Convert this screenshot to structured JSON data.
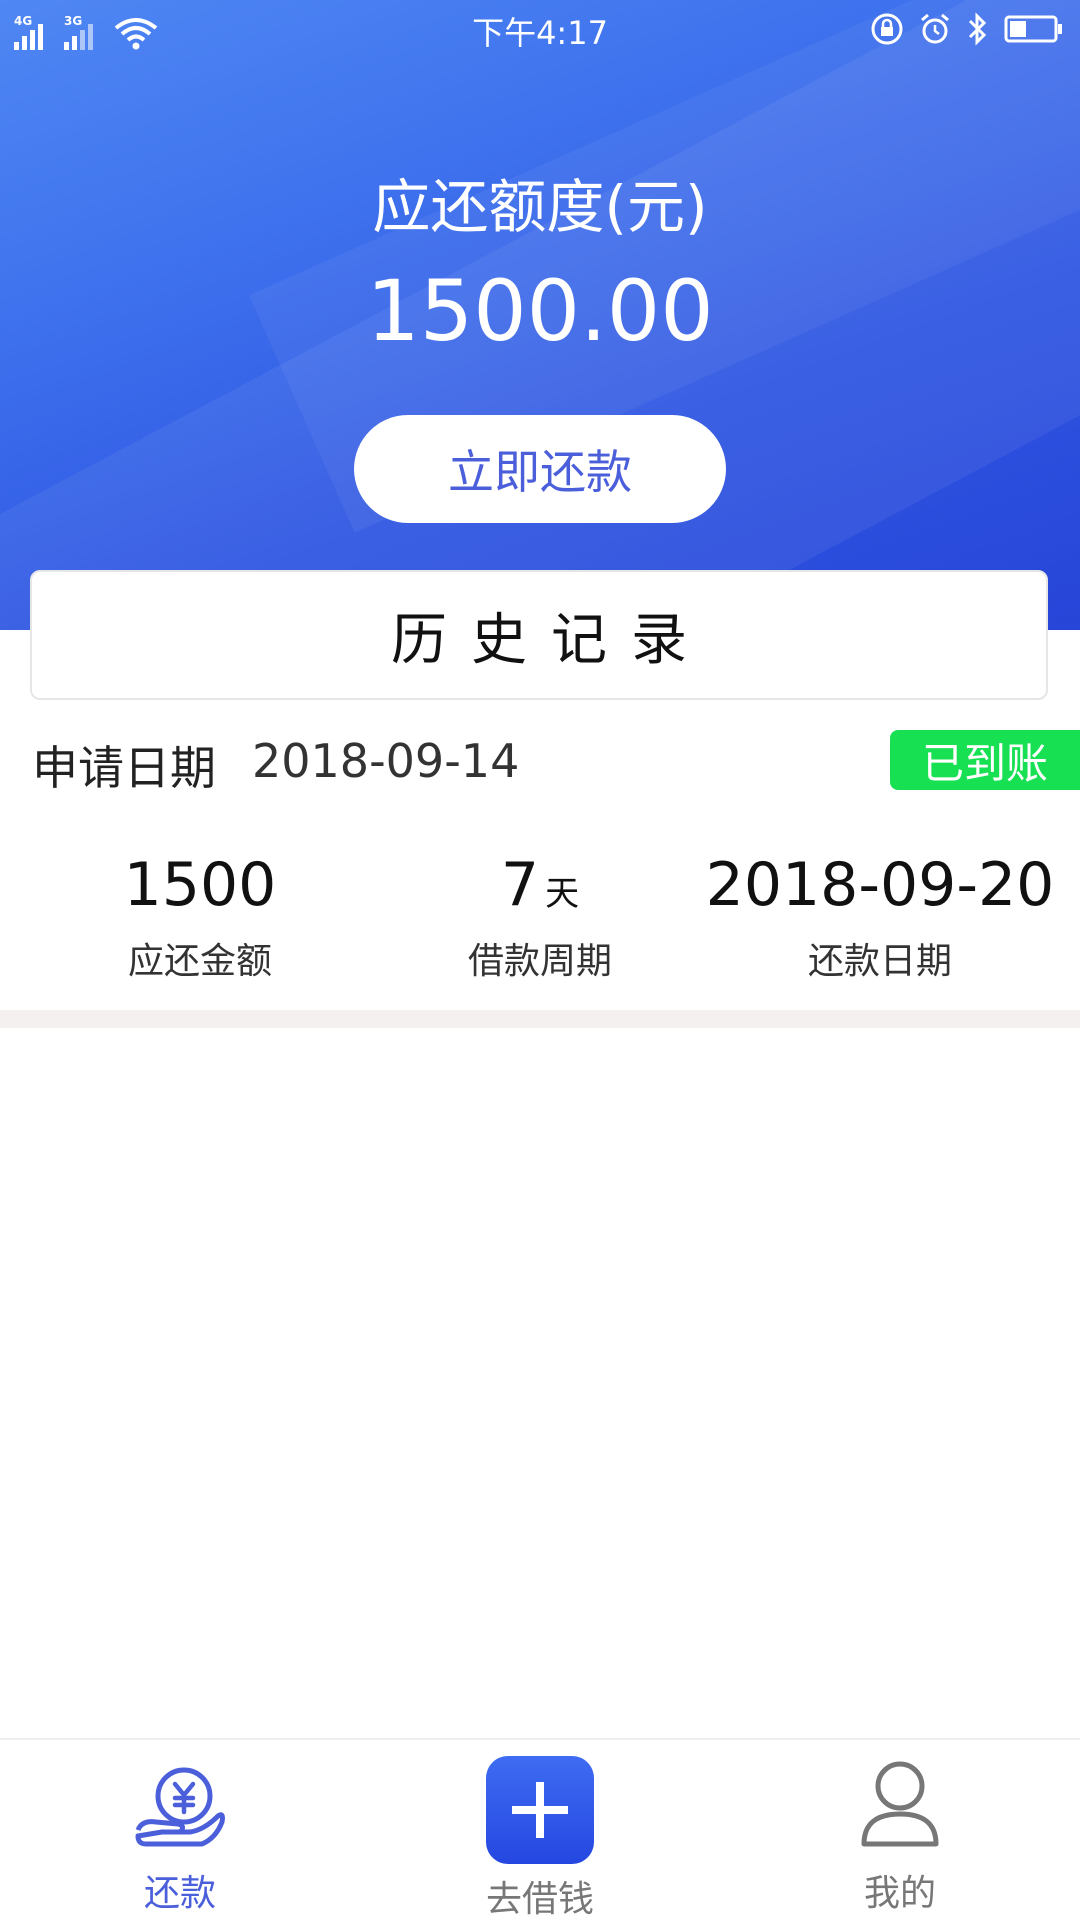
{
  "status_bar": {
    "network_1": "4G",
    "network_2": "3G",
    "time": "下午4:17"
  },
  "repayment": {
    "limit_label": "应还额度(元)",
    "limit_amount": "1500.00",
    "repay_button_label": "立即还款"
  },
  "history": {
    "tab_label": "历史记录",
    "record": {
      "apply_label": "申请日期",
      "apply_date": "2018-09-14",
      "status": "已到账",
      "status_color": "#18e053",
      "stats": [
        {
          "value": "1500",
          "unit": "",
          "label": "应还金额"
        },
        {
          "value": "7",
          "unit": "天",
          "label": "借款周期"
        },
        {
          "value": "2018-09-20",
          "unit": "",
          "label": "还款日期"
        }
      ]
    }
  },
  "tabbar": {
    "items": [
      {
        "label": "还款",
        "icon": "hand-yen-icon",
        "active": true
      },
      {
        "label": "去借钱",
        "icon": "plus-icon",
        "active": false
      },
      {
        "label": "我的",
        "icon": "user-icon",
        "active": false
      }
    ]
  },
  "colors": {
    "accent": "#4b5fdb",
    "hero_start": "#4f87f3",
    "hero_end": "#2745d8",
    "inactive": "#777777"
  }
}
